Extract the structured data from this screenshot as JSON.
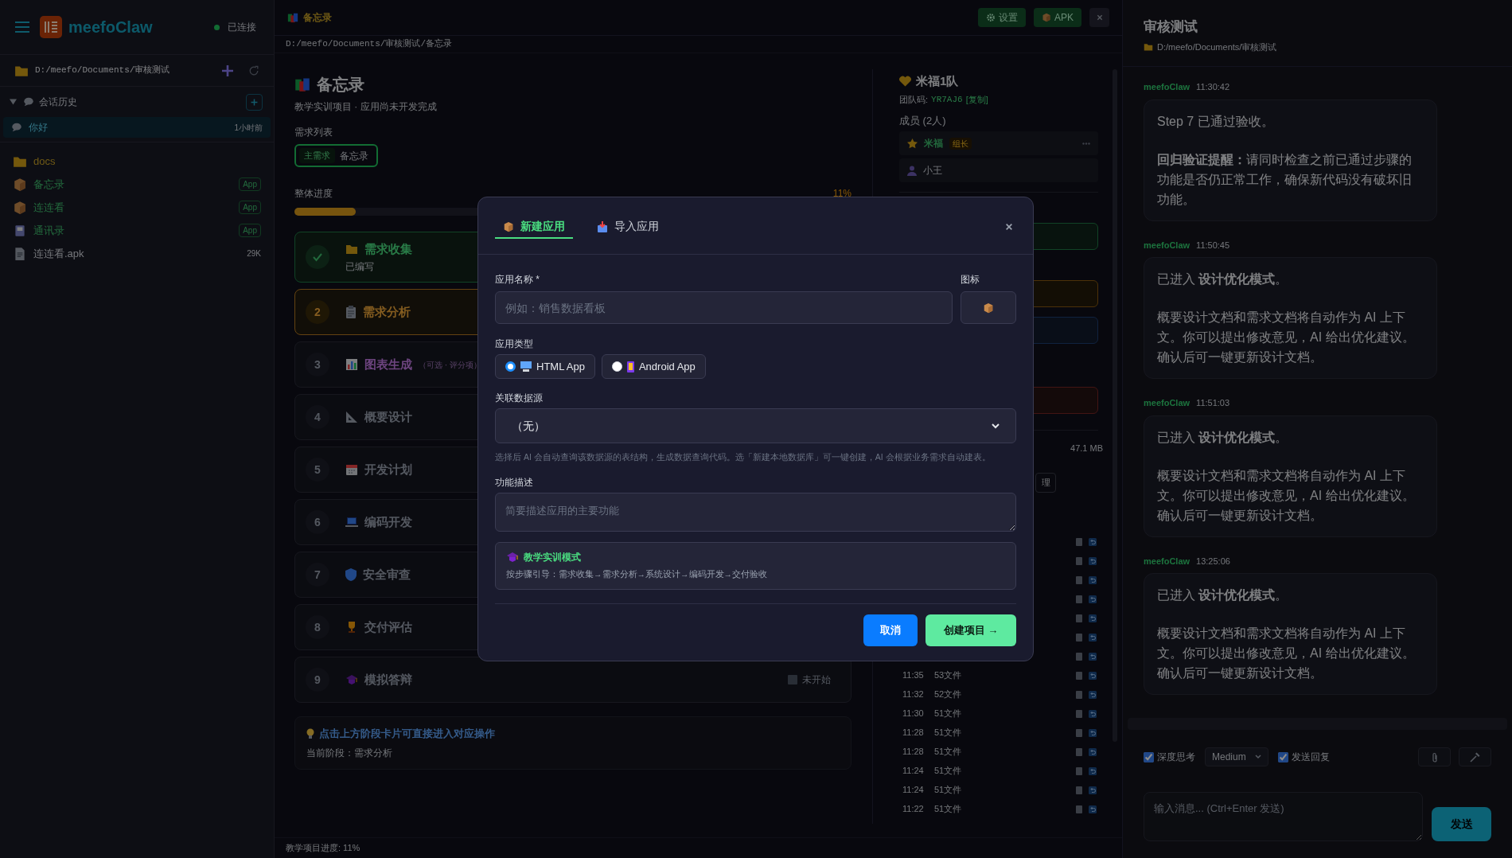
{
  "sidebar": {
    "brand": "meefoClaw",
    "connection": {
      "label": "已连接",
      "on": true
    },
    "path": "D:/meefo/Documents/审核测试",
    "history": {
      "title": "会话历史",
      "expanded": true,
      "items": [
        {
          "title": "你好",
          "time": "1小时前",
          "selected": true
        }
      ]
    },
    "files": [
      {
        "kind": "folder",
        "name": "docs"
      },
      {
        "kind": "app",
        "name": "备忘录",
        "badge": "App"
      },
      {
        "kind": "app",
        "name": "连连看",
        "badge": "App"
      },
      {
        "kind": "contacts",
        "name": "通讯录",
        "badge": "App"
      },
      {
        "kind": "file",
        "name": "连连看.apk",
        "size": "29K"
      }
    ]
  },
  "project": {
    "tab_title": "备忘录",
    "buttons": [
      {
        "kind": "settings",
        "label": "设置"
      },
      {
        "kind": "apk",
        "label": "APK"
      }
    ],
    "path": "D:/meefo/Documents/审核测试/备忘录",
    "title": "备忘录",
    "subtitle": "教学实训项目 · 应用尚未开发完成",
    "requirements": {
      "label": "需求列表",
      "items": [
        {
          "tag": "主需求",
          "name": "备忘录",
          "selected": true
        }
      ]
    },
    "progress": {
      "label": "整体进度",
      "reading": "11%",
      "level": 0.11
    },
    "steps": [
      {
        "done": true,
        "current": false,
        "title": "需求收集",
        "note": "已编写"
      },
      {
        "number": "2",
        "done": false,
        "current": true,
        "title": "需求分析"
      },
      {
        "number": "3",
        "done": false,
        "current": false,
        "title": "图表生成",
        "tag": "（可选 · 评分项）"
      },
      {
        "number": "4",
        "done": false,
        "current": false,
        "title": "概要设计"
      },
      {
        "number": "5",
        "done": false,
        "current": false,
        "title": "开发计划"
      },
      {
        "number": "6",
        "done": false,
        "current": false,
        "title": "编码开发"
      },
      {
        "number": "7",
        "done": false,
        "current": false,
        "title": "安全审查"
      },
      {
        "number": "8",
        "done": false,
        "current": false,
        "title": "交付评估"
      },
      {
        "number": "9",
        "done": false,
        "current": false,
        "title": "模拟答辩",
        "state_label": "未开始"
      }
    ],
    "tip": {
      "title": "点击上方阶段卡片可直接进入对应操作",
      "text": "当前阶段：需求分析"
    },
    "status_bar": "教学项目进度: 11%"
  },
  "team": {
    "name": "米福1队",
    "code_label": "团队码:",
    "code": "YR7AJ6",
    "copy": "[复制]",
    "members_label": "成员 (2人)",
    "members": [
      {
        "name": "米福",
        "role": "组长",
        "leader": true
      },
      {
        "name": "小王",
        "leader": false
      }
    ],
    "storage": "47.1 MB",
    "manage_button": "理",
    "history": [
      {
        "kind": "icons"
      },
      {
        "kind": "icons"
      },
      {
        "kind": "icons"
      },
      {
        "kind": "icons"
      },
      {
        "kind": "icons"
      },
      {
        "kind": "icons"
      },
      {
        "kind": "icons"
      },
      {
        "kind": "entry",
        "time": "11:35",
        "files": "53文件"
      },
      {
        "kind": "entry",
        "time": "11:32",
        "files": "52文件"
      },
      {
        "kind": "entry",
        "time": "11:30",
        "files": "51文件"
      },
      {
        "kind": "entry",
        "time": "11:28",
        "files": "51文件"
      },
      {
        "kind": "entry",
        "time": "11:28",
        "files": "51文件"
      },
      {
        "kind": "entry",
        "time": "11:24",
        "files": "51文件"
      },
      {
        "kind": "entry",
        "time": "11:24",
        "files": "51文件"
      },
      {
        "kind": "entry",
        "time": "11:22",
        "files": "51文件"
      }
    ]
  },
  "chat": {
    "title": "审核测试",
    "path": "D:/meefo/Documents/审核测试",
    "messages": [
      {
        "sender": "meefoClaw",
        "time": "11:30:42",
        "paragraphs": [
          "Step 7 已通过验收。",
          "**回归验证提醒：**请同时检查之前已通过步骤的功能是否仍正常工作，确保新代码没有破坏旧功能。"
        ]
      },
      {
        "sender": "meefoClaw",
        "time": "11:50:45",
        "paragraphs": [
          "已进入 **设计优化模式**。",
          "概要设计文档和需求文档将自动作为 AI 上下文。你可以提出修改意见，AI 给出优化建议。确认后可一键更新设计文档。"
        ]
      },
      {
        "sender": "meefoClaw",
        "time": "11:51:03",
        "paragraphs": [
          "已进入 **设计优化模式**。",
          "概要设计文档和需求文档将自动作为 AI 上下文。你可以提出修改意见，AI 给出优化建议。确认后可一键更新设计文档。"
        ]
      },
      {
        "sender": "meefoClaw",
        "time": "13:25:06",
        "paragraphs": [
          "已进入 **设计优化模式**。",
          "概要设计文档和需求文档将自动作为 AI 上下文。你可以提出修改意见，AI 给出优化建议。确认后可一键更新设计文档。"
        ]
      }
    ],
    "deep_thinking": {
      "label": "深度思考",
      "checked": true
    },
    "effort": "Medium",
    "send_reply": {
      "label": "发送回复",
      "checked": true
    },
    "input": {
      "placeholder": "输入消息... (Ctrl+Enter 发送)"
    },
    "send_button": "发送"
  },
  "modal": {
    "tabs": [
      {
        "label": "新建应用",
        "selected": true
      },
      {
        "label": "导入应用",
        "selected": false
      }
    ],
    "name_label": "应用名称 *",
    "name_field": {
      "placeholder": "例如：销售数据看板"
    },
    "icon_label": "图标",
    "type_label": "应用类型",
    "types": [
      {
        "label": "HTML App",
        "selected": true
      },
      {
        "label": "Android App",
        "selected": false
      }
    ],
    "source_label": "关联数据源",
    "source_value": "（无）",
    "source_help": "选择后 AI 会自动查询该数据源的表结构，生成数据查询代码。选「新建本地数据库」可一键创建，AI 会根据业务需求自动建表。",
    "desc_label": "功能描述",
    "desc_field": {
      "placeholder": "简要描述应用的主要功能"
    },
    "mode": {
      "title": "教学实训模式",
      "text": "按步骤引导：需求收集→需求分析→系统设计→编码开发→交付验收"
    },
    "cancel": "取消",
    "create": "创建项目 →"
  }
}
